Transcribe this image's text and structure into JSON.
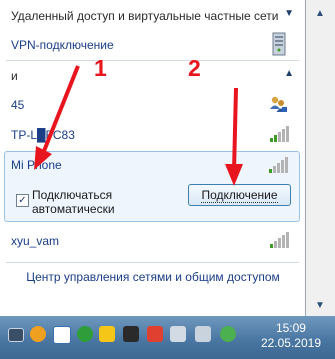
{
  "groups": {
    "remote": {
      "label": "Удаленный доступ и виртуальные частные сети"
    },
    "wireless": {
      "label": "и"
    }
  },
  "vpn": {
    "name": "VPN-подключение"
  },
  "networks": [
    {
      "name": "45"
    },
    {
      "name": "TP-L░░FC83",
      "display": "TP-L",
      "display_suffix": "FC83"
    },
    {
      "name": "Mi Phone",
      "auto_connect_label": "Подключаться автоматически",
      "auto_connect_checked": true,
      "connect_button": "Подключение"
    },
    {
      "name": "xyu_vam"
    }
  ],
  "footer": {
    "link": "Центр управления сетями и общим доступом"
  },
  "clock": {
    "time": "15:09",
    "date": "22.05.2019"
  },
  "annotations": {
    "arrow1": "1",
    "arrow2": "2"
  },
  "colors": {
    "accent_red": "#e8141e",
    "link_blue": "#1b3e87",
    "signal_green": "#3e9b26"
  },
  "icons": [
    "vpn-server-icon",
    "chevron-up-icon",
    "chevron-down-icon",
    "network-users-icon",
    "wifi-signal-icon",
    "checkmark-icon",
    "network-tray-icon"
  ]
}
